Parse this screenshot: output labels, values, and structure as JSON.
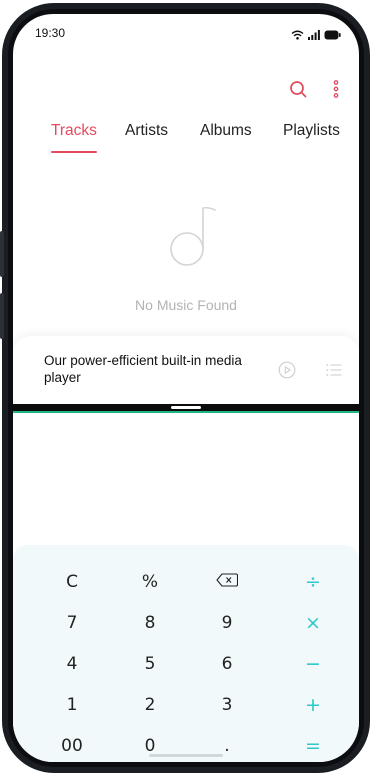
{
  "status_bar": {
    "time": "19:30"
  },
  "music_app": {
    "tabs": [
      {
        "label": "Tracks",
        "active": true
      },
      {
        "label": "Artists",
        "active": false
      },
      {
        "label": "Albums",
        "active": false
      },
      {
        "label": "Playlists",
        "active": false
      }
    ],
    "empty_state_text": "No Music Found",
    "player": {
      "title": "Our power-efficient built-in media player"
    }
  },
  "calculator": {
    "keys": [
      [
        "C",
        "%",
        "backspace",
        "÷"
      ],
      [
        "7",
        "8",
        "9",
        "×"
      ],
      [
        "4",
        "5",
        "6",
        "−"
      ],
      [
        "1",
        "2",
        "3",
        "+"
      ],
      [
        "00",
        "0",
        ".",
        "="
      ]
    ]
  },
  "colors": {
    "accent_red": "#e34a5e",
    "operator_teal": "#2fc7c7",
    "divider_green": "#21b681",
    "keypad_bg": "#f1f9fb"
  },
  "icons": [
    "wifi-icon",
    "signal-icon",
    "battery-icon",
    "search-icon",
    "more-vertical-icon",
    "music-note-icon",
    "play-circle-icon",
    "playlist-icon",
    "backspace-icon"
  ]
}
